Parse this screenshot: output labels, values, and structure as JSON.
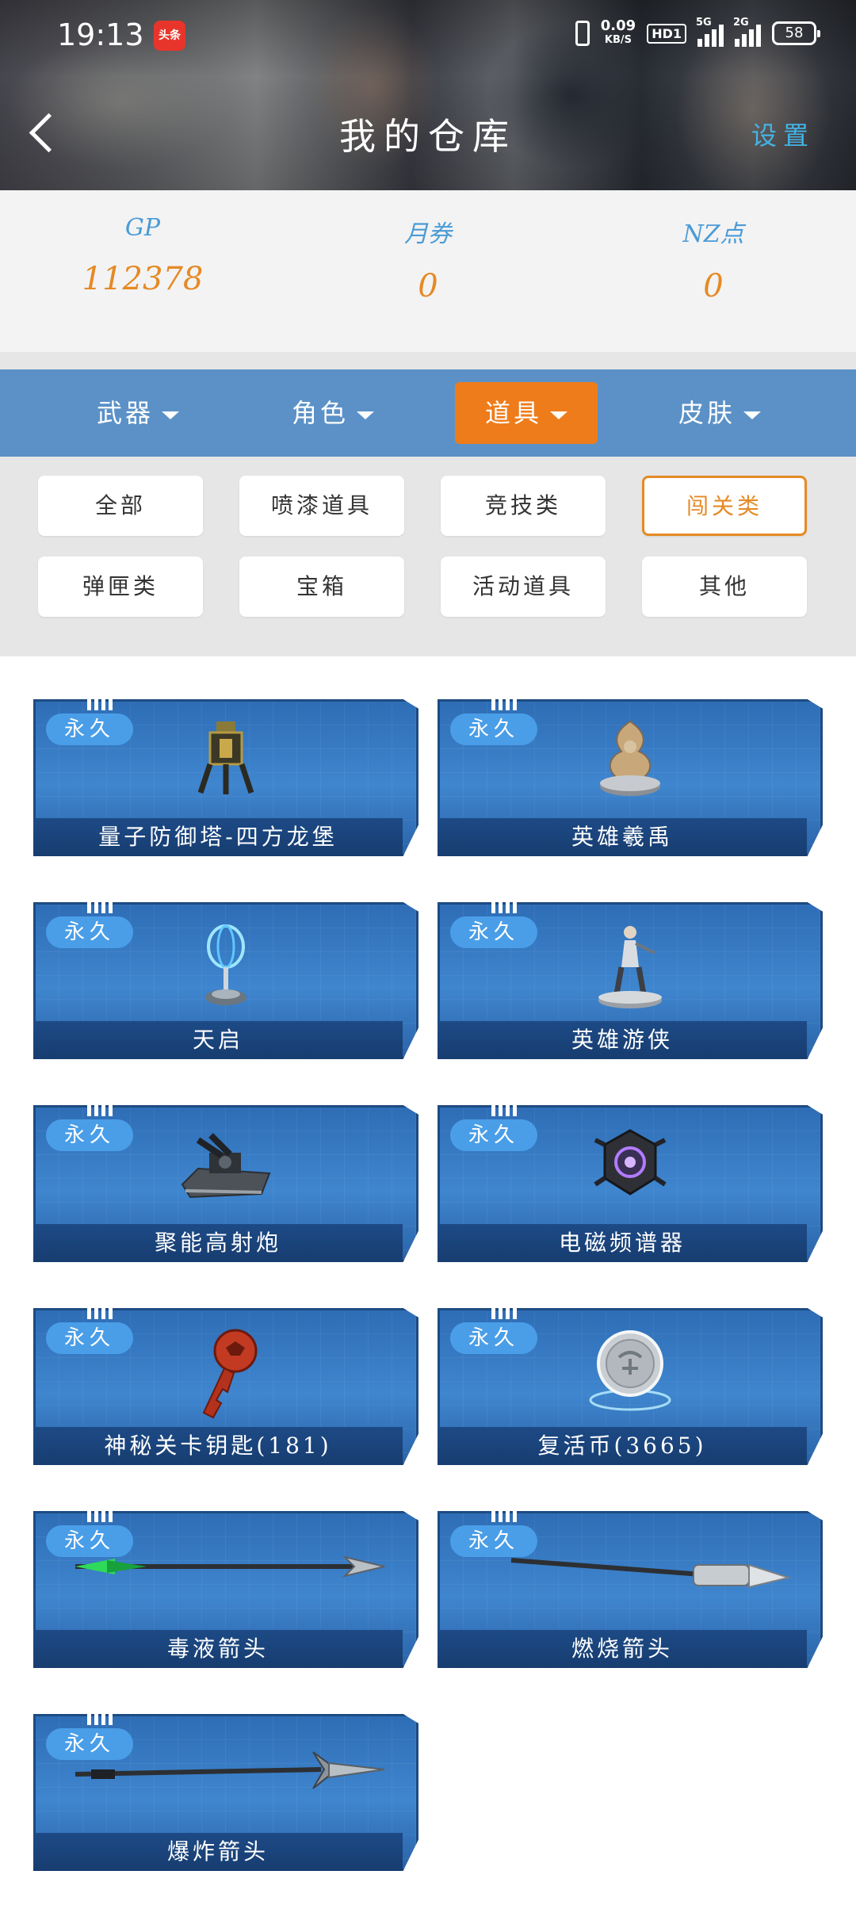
{
  "status_bar": {
    "time": "19:13",
    "app_badge": "头条",
    "net_speed": "0.09",
    "net_unit": "KB/S",
    "hd": "HD1",
    "sig1_label": "5G",
    "sig2_label": "2G",
    "battery": "58"
  },
  "header": {
    "title": "我的仓库",
    "settings_label": "设置",
    "back_icon": "chevron-left-icon"
  },
  "currency": [
    {
      "label": "GP",
      "value": "112378"
    },
    {
      "label": "月券",
      "value": "0"
    },
    {
      "label": "NZ点",
      "value": "0"
    }
  ],
  "categories": [
    {
      "label": "武器",
      "active": false
    },
    {
      "label": "角色",
      "active": false
    },
    {
      "label": "道具",
      "active": true
    },
    {
      "label": "皮肤",
      "active": false
    }
  ],
  "subfilters": [
    {
      "label": "全部",
      "active": false
    },
    {
      "label": "喷漆道具",
      "active": false
    },
    {
      "label": "竞技类",
      "active": false
    },
    {
      "label": "闯关类",
      "active": true
    },
    {
      "label": "弹匣类",
      "active": false
    },
    {
      "label": "宝箱",
      "active": false
    },
    {
      "label": "活动道具",
      "active": false
    },
    {
      "label": "其他",
      "active": false
    }
  ],
  "items": [
    {
      "badge": "永久",
      "name": "量子防御塔-四方龙堡",
      "icon": "tower-icon"
    },
    {
      "badge": "永久",
      "name": "英雄羲禹",
      "icon": "hero-statue-icon"
    },
    {
      "badge": "永久",
      "name": "天启",
      "icon": "beacon-icon"
    },
    {
      "badge": "永久",
      "name": "英雄游侠",
      "icon": "hero-figure-icon"
    },
    {
      "badge": "永久",
      "name": "聚能高射炮",
      "icon": "cannon-icon"
    },
    {
      "badge": "永久",
      "name": "电磁频谱器",
      "icon": "emitter-icon"
    },
    {
      "badge": "永久",
      "name": "神秘关卡钥匙(181)",
      "icon": "key-icon"
    },
    {
      "badge": "永久",
      "name": "复活币(3665)",
      "icon": "coin-icon"
    },
    {
      "badge": "永久",
      "name": "毒液箭头",
      "icon": "arrow-icon"
    },
    {
      "badge": "永久",
      "name": "燃烧箭头",
      "icon": "arrow-icon"
    },
    {
      "badge": "永久",
      "name": "爆炸箭头",
      "icon": "arrow-icon"
    }
  ],
  "colors": {
    "accent_orange": "#ef7c1a",
    "category_bar": "#5b91c7",
    "card_blue": "#3f86cf",
    "label_blue": "#4a9bd6"
  }
}
